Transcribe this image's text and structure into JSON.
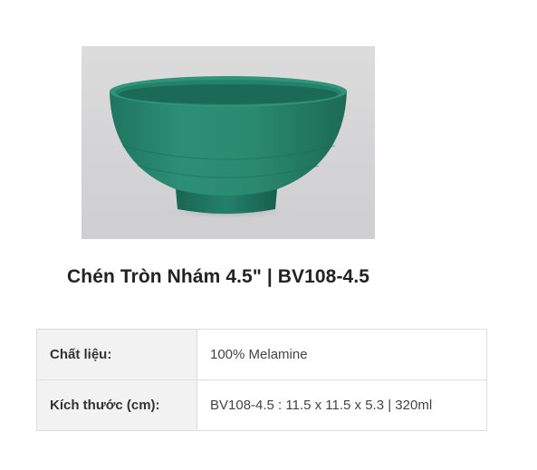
{
  "product": {
    "image_alt": "green melamine bowl",
    "title": "Chén Tròn Nhám 4.5\" | BV108-4.5",
    "colors": {
      "bowl": "#2a8c72",
      "bowl_dark": "#1d6b56",
      "background": "#d6d6d8"
    }
  },
  "specs": {
    "rows": [
      {
        "label": "Chất liệu:",
        "value": "100% Melamine"
      },
      {
        "label": "Kích thước (cm):",
        "value": "BV108-4.5 : 11.5 x 11.5 x 5.3 | 320ml"
      }
    ]
  }
}
